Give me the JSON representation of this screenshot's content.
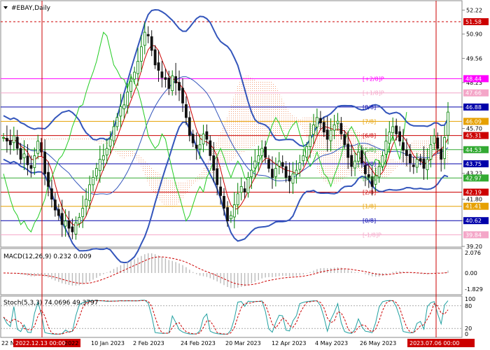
{
  "chart_data": [
    {
      "type": "candlestick",
      "title": "#EBAY,Daily",
      "symbol": "#EBAY",
      "timeframe": "Daily",
      "ylim": [
        39.2,
        52.7
      ],
      "price_ticks": [
        "52.22",
        "50.90",
        "49.56",
        "48.23",
        "46.88",
        "45.70",
        "44.53",
        "43.23",
        "41.80",
        "40.62",
        "39.20"
      ],
      "level_labels": [
        {
          "value": 51.58,
          "text": "51.58",
          "color": "#cc0000"
        },
        {
          "value": 48.44,
          "text": "48.44",
          "color": "#ff00ff"
        },
        {
          "value": 47.66,
          "text": "47.66",
          "color": "#f4a6c8"
        },
        {
          "value": 46.88,
          "text": "46.88",
          "color": "#0000aa"
        },
        {
          "value": 46.09,
          "text": "46.09",
          "color": "#e6a000"
        },
        {
          "value": 45.31,
          "text": "45.31",
          "color": "#cc0000"
        },
        {
          "value": 44.53,
          "text": "44.53",
          "color": "#33aa33"
        },
        {
          "value": 43.75,
          "text": "43.75",
          "color": "#0000aa"
        },
        {
          "value": 42.97,
          "text": "42.97",
          "color": "#33aa33"
        },
        {
          "value": 42.19,
          "text": "42.19",
          "color": "#cc0000"
        },
        {
          "value": 41.41,
          "text": "41.41",
          "color": "#e6a000"
        },
        {
          "value": 40.62,
          "text": "40.62",
          "color": "#0000aa"
        },
        {
          "value": 39.84,
          "text": "39.84",
          "color": "#f4a6c8"
        }
      ],
      "murrey_labels": [
        {
          "text": "[+2/8]P",
          "value": 48.44,
          "color": "#ff00ff"
        },
        {
          "text": "[+1/8]P",
          "value": 47.66,
          "color": "#f4a6c8"
        },
        {
          "text": "[8/8]",
          "value": 46.88,
          "color": "#0000aa"
        },
        {
          "text": "[7/8]",
          "value": 46.09,
          "color": "#e6a000"
        },
        {
          "text": "[6/8]",
          "value": 45.31,
          "color": "#cc0000"
        },
        {
          "text": "[5/8]",
          "value": 44.53,
          "color": "#33aa33"
        },
        {
          "text": "[4/8]",
          "value": 43.75,
          "color": "#0000aa"
        },
        {
          "text": "[3/8]",
          "value": 42.97,
          "color": "#33aa33"
        },
        {
          "text": "[2/8]",
          "value": 42.19,
          "color": "#cc0000"
        },
        {
          "text": "[1/8]",
          "value": 41.41,
          "color": "#e6a000"
        },
        {
          "text": "[0/8]",
          "value": 40.62,
          "color": "#0000aa"
        },
        {
          "text": "[-1/8]P",
          "value": 39.84,
          "color": "#f4a6c8"
        }
      ],
      "x_labels": [
        "22 Nov 2022",
        "2022.12.13 00:00",
        "2022",
        "10 Jan 2023",
        "2 Feb 2023",
        "24 Feb 2023",
        "20 Mar 2023",
        "12 Apr 2023",
        "4 May 2023",
        "26 May 2023",
        "2023.07.06 00:00"
      ],
      "close": [
        45.2,
        45.0,
        44.8,
        45.3,
        44.6,
        44.0,
        44.3,
        43.7,
        43.5,
        44.2,
        45.0,
        44.4,
        43.2,
        42.5,
        41.8,
        41.2,
        40.9,
        40.4,
        40.6,
        40.2,
        40.0,
        40.5,
        40.8,
        41.3,
        41.8,
        42.6,
        43.0,
        43.5,
        44.0,
        44.2,
        44.6,
        45.1,
        45.8,
        46.3,
        46.9,
        47.0,
        47.7,
        48.3,
        48.8,
        49.4,
        50.2,
        51.0,
        50.8,
        50.0,
        49.2,
        48.9,
        48.5,
        48.4,
        47.9,
        48.6,
        48.2,
        47.8,
        47.1,
        46.3,
        45.3,
        44.9,
        44.6,
        44.8,
        45.4,
        45.1,
        44.2,
        43.4,
        42.6,
        42.0,
        41.3,
        40.6,
        40.9,
        41.5,
        42.1,
        42.5,
        42.2,
        43.0,
        43.4,
        43.9,
        44.2,
        44.6,
        44.1,
        43.5,
        43.0,
        43.5,
        43.9,
        43.6,
        43.0,
        42.8,
        43.2,
        43.4,
        43.8,
        44.2,
        44.7,
        45.3,
        45.9,
        46.3,
        46.0,
        45.5,
        45.1,
        45.6,
        45.9,
        46.1,
        45.4,
        44.8,
        44.1,
        43.6,
        43.9,
        44.4,
        43.8,
        43.2,
        43.0,
        42.5,
        43.1,
        43.6,
        44.2,
        45.0,
        45.5,
        45.8,
        45.4,
        45.0,
        44.5,
        44.2,
        43.8,
        43.6,
        44.0,
        43.9,
        43.5,
        44.0,
        44.8,
        45.3,
        44.6,
        44.0,
        45.2,
        46.6
      ],
      "indicators": [
        {
          "name": "MACD",
          "params": "12,26,9",
          "value": "0.232",
          "signal": "0.009",
          "ticks": [
            "2.076",
            "0.00",
            "-1.829"
          ]
        },
        {
          "name": "Stoch",
          "params": "5,3,3",
          "value": "74.0696",
          "signal": "49.3797",
          "ticks": [
            "100",
            "80",
            "20",
            "0"
          ]
        }
      ]
    }
  ],
  "colors": {
    "candle_up": "#008000",
    "candle_down": "#111111",
    "bollinger": "#3355bb",
    "fast_ma": "#cc0000",
    "lagging_line": "#22cc22",
    "cloud": "#f2a07a",
    "marker_line": "#cc0000",
    "panel_border": "#888888"
  }
}
